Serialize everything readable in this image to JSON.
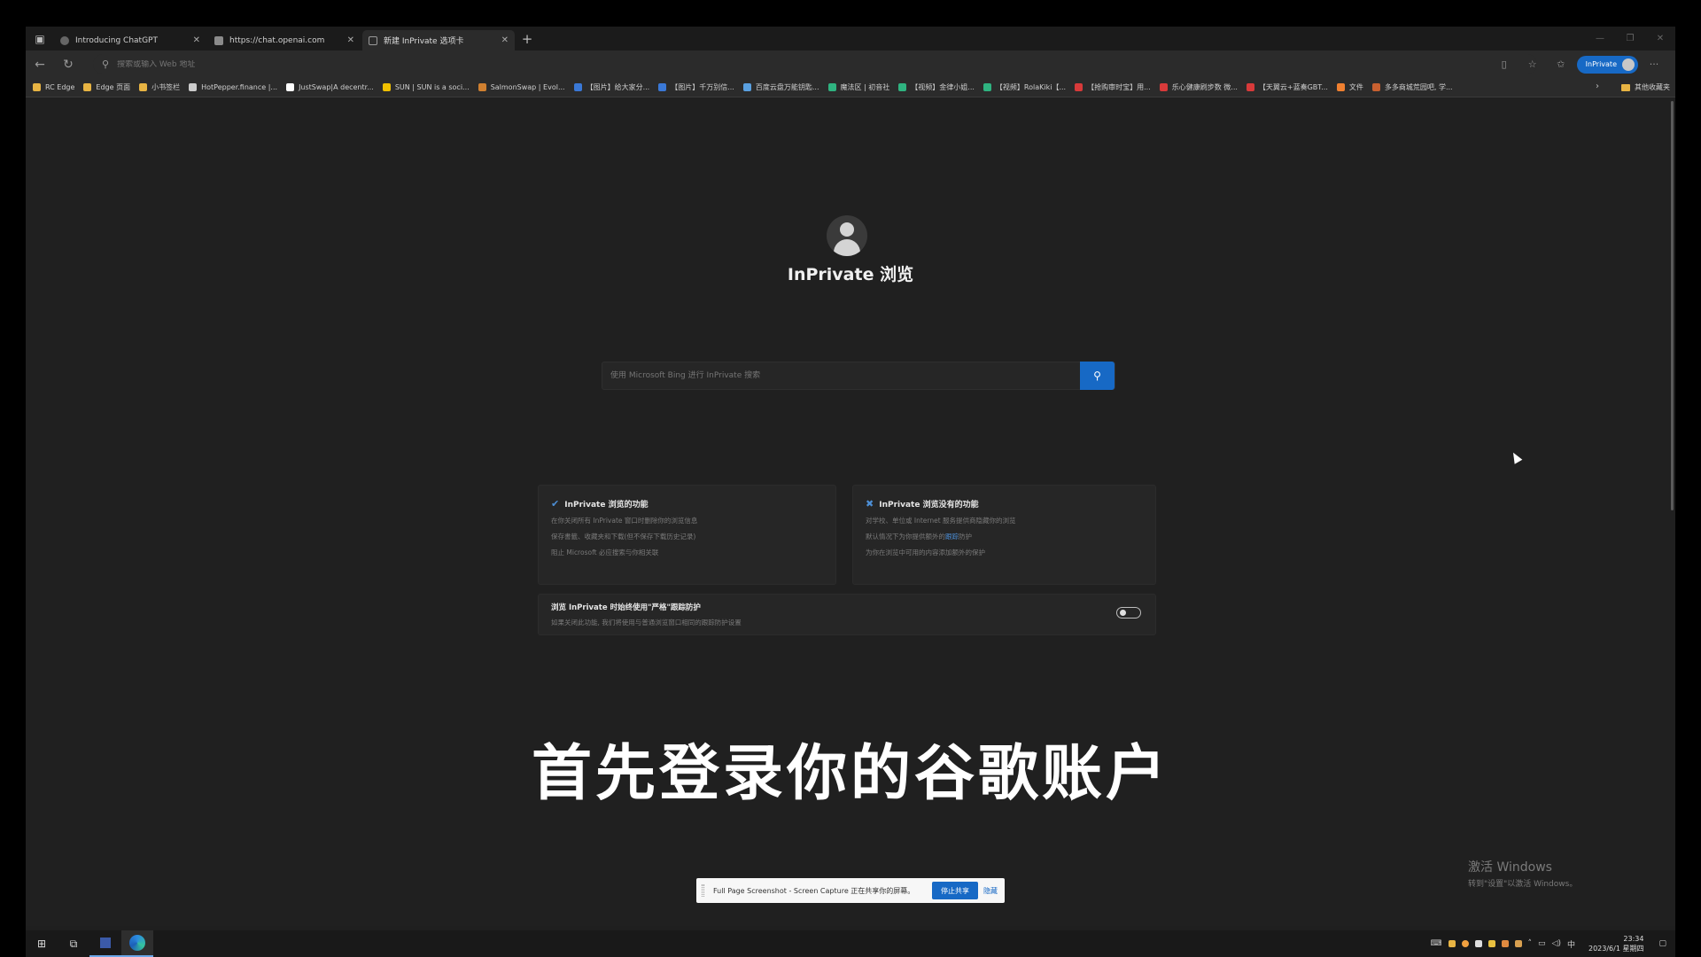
{
  "browser": {
    "tabs": [
      {
        "title": "Introducing ChatGPT",
        "color": "#666666"
      },
      {
        "title": "https://chat.openai.com",
        "color": "#8a8a8a"
      },
      {
        "title": "新建 InPrivate 选项卡",
        "color": "#444444"
      }
    ],
    "address_placeholder": "搜索或输入 Web 地址",
    "inprivate_label": "InPrivate",
    "favorites": [
      {
        "label": "RC Edge",
        "color": "#e8b443"
      },
      {
        "label": "Edge 页面",
        "color": "#e8b443"
      },
      {
        "label": "小书签栏",
        "color": "#e8b443"
      },
      {
        "label": "HotPepper.finance |...",
        "color": "#cccccc"
      },
      {
        "label": "JustSwap|A decentr...",
        "color": "#ffffff"
      },
      {
        "label": "SUN | SUN is a soci...",
        "color": "#f0c000"
      },
      {
        "label": "SalmonSwap | Evol...",
        "color": "#d08030"
      },
      {
        "label": "【图片】给大家分...",
        "color": "#3a78d6"
      },
      {
        "label": "【图片】千万别信...",
        "color": "#3a78d6"
      },
      {
        "label": "百度云盘万能钥匙...",
        "color": "#5aa0e0"
      },
      {
        "label": "魔法区 | 初音社",
        "color": "#2fb380"
      },
      {
        "label": "【视频】金律小姐...",
        "color": "#2fb380"
      },
      {
        "label": "【视频】RolaKiki【...",
        "color": "#2fb380"
      },
      {
        "label": "【抢购审时宝】用...",
        "color": "#d83a3a"
      },
      {
        "label": "乐心健康刷步数 微...",
        "color": "#d83a3a"
      },
      {
        "label": "【天翼云+蓝奏GBT...",
        "color": "#d83a3a"
      },
      {
        "label": "文件",
        "color": "#f08030"
      },
      {
        "label": "多多商城荒园吧, 学...",
        "color": "#c86030"
      }
    ],
    "favorites_other": "其他收藏夹"
  },
  "page": {
    "heading": "InPrivate 浏览",
    "search_placeholder": "使用 Microsoft Bing 进行 InPrivate 搜索",
    "does_card": {
      "title": "InPrivate 浏览的功能",
      "lines": [
        "在你关闭所有 InPrivate 窗口时删除你的浏览信息",
        "保存書籤、收藏夹和下载(但不保存下载历史记录)",
        "阻止 Microsoft 必应搜索与你相关联"
      ]
    },
    "doesnt_card": {
      "title": "InPrivate 浏览没有的功能",
      "line1": "对学校、单位或 Internet 服务提供商隐藏你的浏览",
      "line2_prefix": "默认情况下为你提供额外的",
      "line2_link": "跟踪",
      "line2_suffix": "防护",
      "line3": "为你在浏览中可用的内容添加额外的保护"
    },
    "strict": {
      "title": "浏览 InPrivate 时始终使用\"严格\"跟踪防护",
      "subtitle": "如果关闭此功能, 我们将使用与普通浏览窗口相同的跟踪防护设置",
      "enabled": false
    }
  },
  "overlay": {
    "video_subtitle": "首先登录你的谷歌账户",
    "share_message": "Full Page Screenshot - Screen Capture 正在共享你的屏幕。",
    "share_stop": "停止共享",
    "share_hide": "隐藏",
    "watermark_title": "激活 Windows",
    "watermark_sub": "转到\"设置\"以激活 Windows。"
  },
  "taskbar": {
    "time": "23:34",
    "date": "2023/6/1 星期四",
    "ime": "中"
  },
  "colors": {
    "accent": "#1769c5",
    "background": "#202020"
  }
}
